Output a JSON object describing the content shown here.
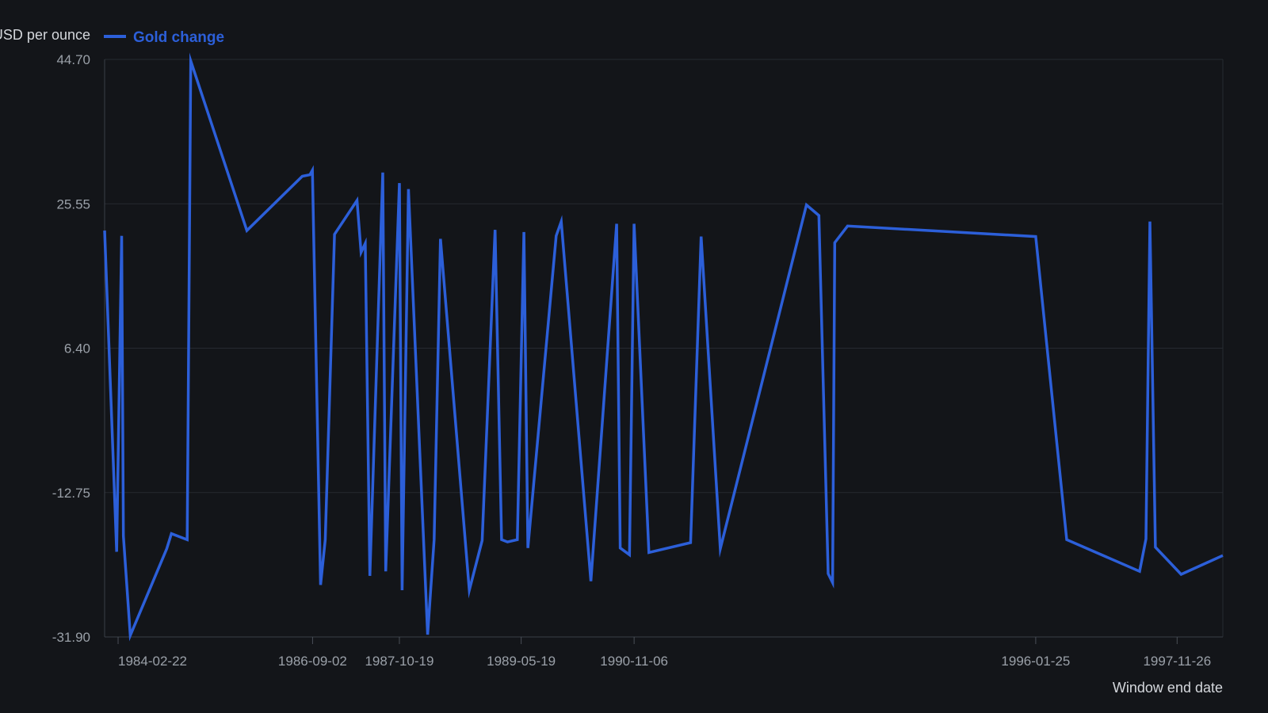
{
  "chart_data": {
    "type": "line",
    "title": "",
    "ylabel": "USD per ounce",
    "xlabel": "Window end date",
    "ylim": [
      -31.9,
      44.7
    ],
    "y_ticks": [
      "44.70",
      "25.55",
      "6.40",
      "-12.75",
      "-31.90"
    ],
    "x_range": [
      "1983-12-20",
      "1998-07-01"
    ],
    "x_ticks": [
      {
        "date": "1984-02-22",
        "label": "1984-02-22"
      },
      {
        "date": "1986-09-02",
        "label": "1986-09-02"
      },
      {
        "date": "1987-10-19",
        "label": "1987-10-19"
      },
      {
        "date": "1989-05-19",
        "label": "1989-05-19"
      },
      {
        "date": "1990-11-06",
        "label": "1990-11-06"
      },
      {
        "date": "1996-01-25",
        "label": "1996-01-25"
      },
      {
        "date": "1997-11-26",
        "label": "1997-11-26"
      }
    ],
    "grid": true,
    "legend_position": "top-left",
    "series": [
      {
        "name": "Gold change",
        "color": "#2c5fd9",
        "points": [
          {
            "x": "1983-12-20",
            "y": 22.0
          },
          {
            "x": "1984-02-15",
            "y": -20.6
          },
          {
            "x": "1984-03-10",
            "y": 21.3
          },
          {
            "x": "1984-03-18",
            "y": -18.5
          },
          {
            "x": "1984-04-20",
            "y": -31.7
          },
          {
            "x": "1984-10-10",
            "y": -20.2
          },
          {
            "x": "1984-11-01",
            "y": -18.2
          },
          {
            "x": "1985-01-15",
            "y": -19.0
          },
          {
            "x": "1985-02-01",
            "y": 44.5
          },
          {
            "x": "1985-10-25",
            "y": 22.0
          },
          {
            "x": "1986-07-15",
            "y": 29.2
          },
          {
            "x": "1986-08-20",
            "y": 29.4
          },
          {
            "x": "1986-09-01",
            "y": 30.0
          },
          {
            "x": "1986-10-10",
            "y": -25.0
          },
          {
            "x": "1986-11-01",
            "y": -19.0
          },
          {
            "x": "1986-12-15",
            "y": 21.5
          },
          {
            "x": "1987-04-01",
            "y": 26.0
          },
          {
            "x": "1987-04-20",
            "y": 19.1
          },
          {
            "x": "1987-05-10",
            "y": 20.3
          },
          {
            "x": "1987-06-01",
            "y": -23.8
          },
          {
            "x": "1987-08-01",
            "y": 29.7
          },
          {
            "x": "1987-08-15",
            "y": -23.2
          },
          {
            "x": "1987-10-19",
            "y": 28.3
          },
          {
            "x": "1987-11-01",
            "y": -25.7
          },
          {
            "x": "1987-12-01",
            "y": 27.5
          },
          {
            "x": "1988-03-01",
            "y": -31.6
          },
          {
            "x": "1988-04-01",
            "y": -19.0
          },
          {
            "x": "1988-05-01",
            "y": 20.9
          },
          {
            "x": "1988-09-15",
            "y": -25.7
          },
          {
            "x": "1988-11-15",
            "y": -19.1
          },
          {
            "x": "1989-01-15",
            "y": 22.1
          },
          {
            "x": "1989-02-15",
            "y": -19.0
          },
          {
            "x": "1989-03-15",
            "y": -19.3
          },
          {
            "x": "1989-05-01",
            "y": -19.0
          },
          {
            "x": "1989-06-01",
            "y": 21.8
          },
          {
            "x": "1989-06-20",
            "y": -20.1
          },
          {
            "x": "1989-11-01",
            "y": 21.3
          },
          {
            "x": "1989-11-25",
            "y": 23.2
          },
          {
            "x": "1990-04-15",
            "y": -24.5
          },
          {
            "x": "1990-08-15",
            "y": 22.9
          },
          {
            "x": "1990-09-01",
            "y": -20.1
          },
          {
            "x": "1990-10-15",
            "y": -21.0
          },
          {
            "x": "1990-11-06",
            "y": 22.9
          },
          {
            "x": "1991-01-15",
            "y": -20.7
          },
          {
            "x": "1991-08-01",
            "y": -19.4
          },
          {
            "x": "1991-09-20",
            "y": 21.2
          },
          {
            "x": "1991-12-20",
            "y": -20.2
          },
          {
            "x": "1993-02-01",
            "y": 25.4
          },
          {
            "x": "1993-04-01",
            "y": 24.0
          },
          {
            "x": "1993-05-15",
            "y": -23.5
          },
          {
            "x": "1993-06-05",
            "y": -24.7
          },
          {
            "x": "1993-06-15",
            "y": 20.4
          },
          {
            "x": "1993-08-15",
            "y": 22.6
          },
          {
            "x": "1996-01-25",
            "y": 21.2
          },
          {
            "x": "1996-06-20",
            "y": -19.0
          },
          {
            "x": "1997-06-01",
            "y": -23.2
          },
          {
            "x": "1997-07-01",
            "y": -18.9
          },
          {
            "x": "1997-07-20",
            "y": 23.2
          },
          {
            "x": "1997-08-15",
            "y": -20.0
          },
          {
            "x": "1997-12-15",
            "y": -23.6
          },
          {
            "x": "1998-07-01",
            "y": -21.1
          }
        ]
      }
    ]
  }
}
